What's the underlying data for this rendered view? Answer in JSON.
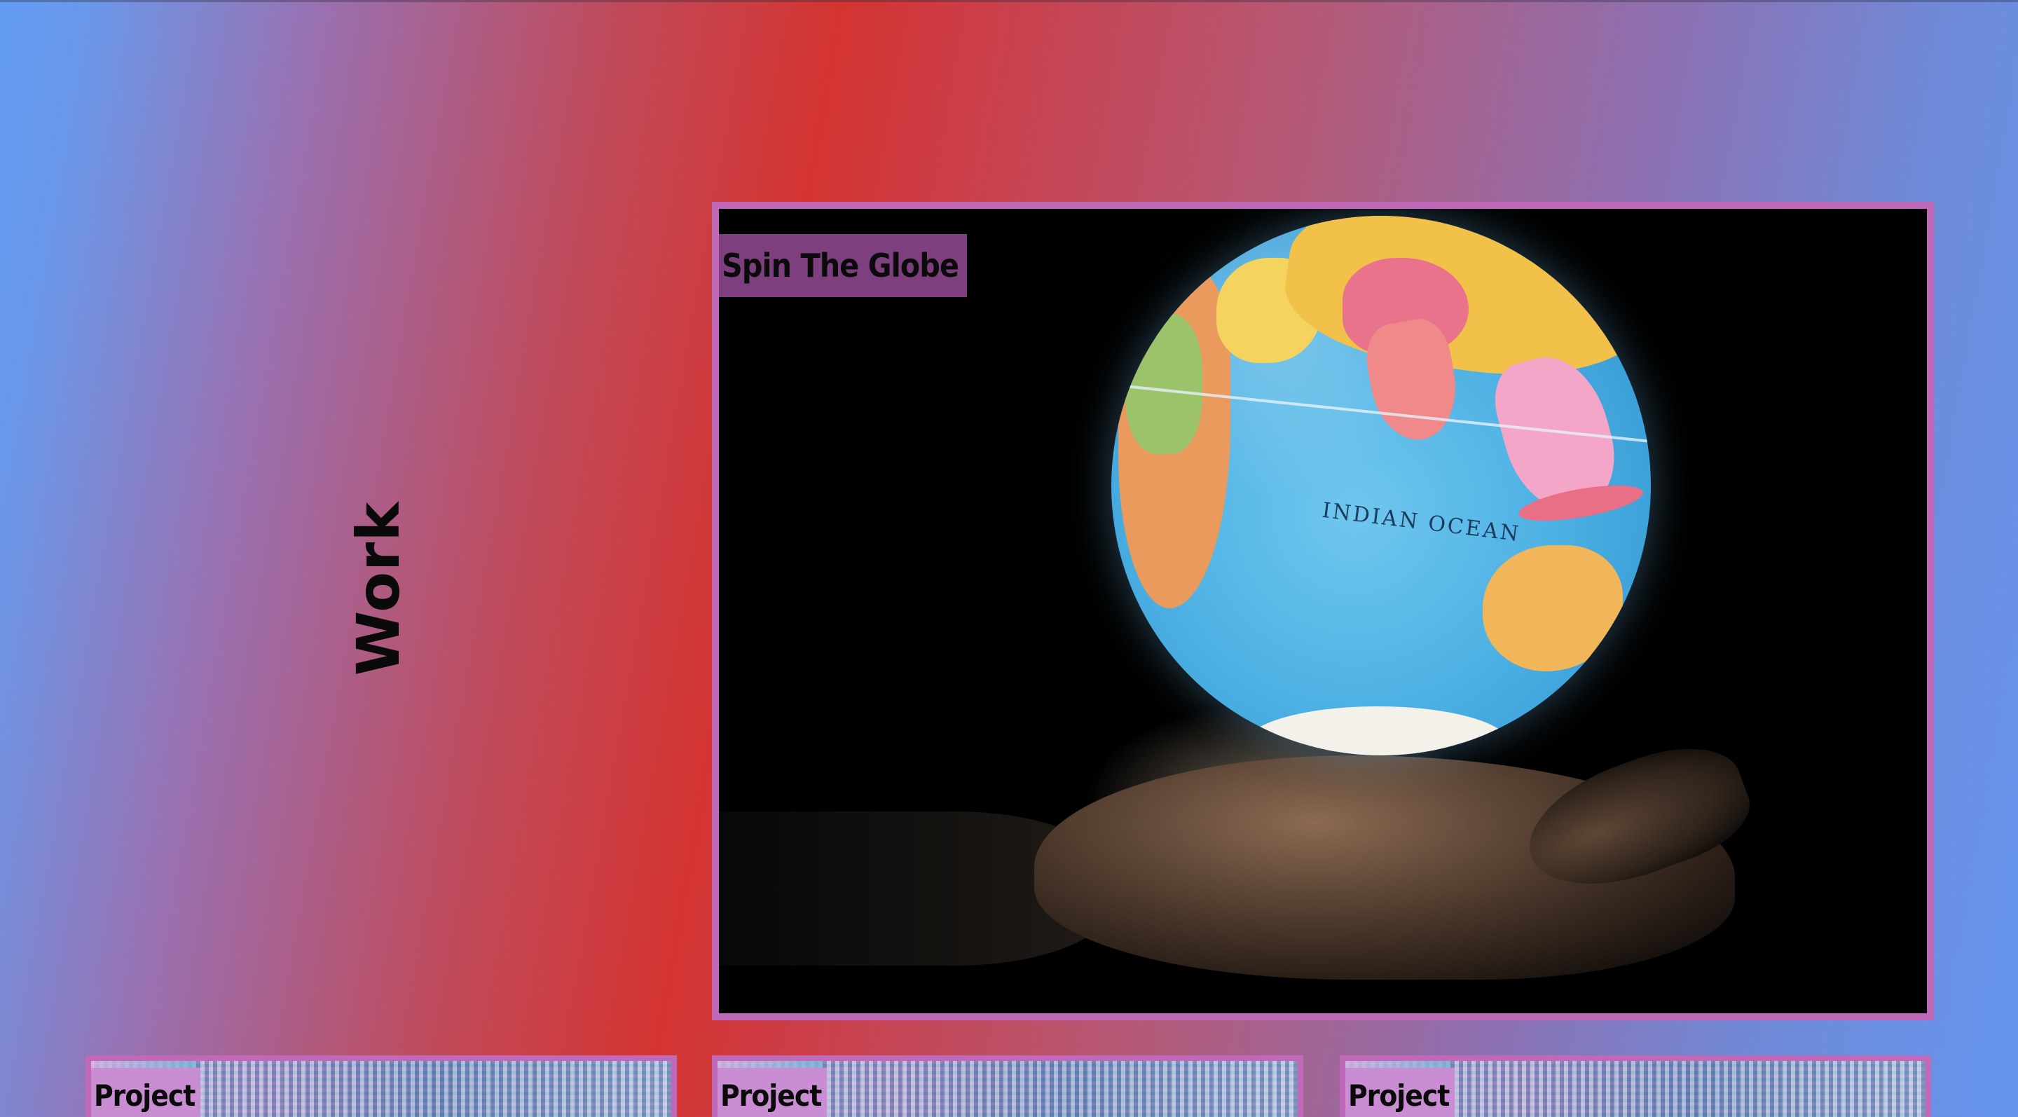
{
  "section": {
    "title": "Work"
  },
  "featured": {
    "label": "Spin The Globe",
    "image_subject": "globe-on-hand",
    "globe_text": "INDIAN OCEAN"
  },
  "projects": [
    {
      "label": "Project"
    },
    {
      "label": "Project"
    },
    {
      "label": "Project"
    }
  ],
  "colors": {
    "gradient_left": "#629cf2",
    "gradient_mid": "#d43431",
    "gradient_right": "#6495ee",
    "card_border": "#c069b8",
    "featured_label_bg": "#7e3f7e",
    "project_label_bg": "#c98ed2"
  }
}
